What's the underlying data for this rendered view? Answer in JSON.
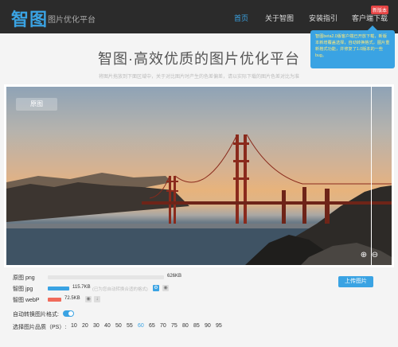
{
  "header": {
    "logo": "智图",
    "subtitle": "图片优化平台",
    "nav": [
      {
        "label": "首页",
        "active": true
      },
      {
        "label": "关于智图",
        "active": false
      },
      {
        "label": "安装指引",
        "active": false
      },
      {
        "label": "客户端下载",
        "active": false
      }
    ],
    "new_badge": "新版本",
    "bubble_text": "智图beta2.0版客户端已开放下载，新版本新增覆盖选择，自动转换格式，图片重新格式功能，并修复了1.0版本的一些bug。"
  },
  "main": {
    "title": "智图·高效优质的图片优化平台",
    "hint": "将图片拖放到下面区域中，关于对比图片时产生的色差偏差，请以实际下载的图片色差对比为准"
  },
  "preview": {
    "original_button": "原图"
  },
  "results": {
    "rows": [
      {
        "label": "原图 png",
        "size": "626KB",
        "fraction": 1.0
      },
      {
        "label": "智图 jpg",
        "size": "115.7KB",
        "note": "(已为您自动转换合适的格式)",
        "fraction": 0.185
      },
      {
        "label": "智图 webP",
        "size": "72.5KB",
        "fraction": 0.116
      }
    ],
    "upload_button": "上传图片",
    "auto_convert_label": "自动转换图片格式:",
    "auto_convert_on": true,
    "quality_label": "选择图片品质（PS）:",
    "quality_options": [
      "10",
      "20",
      "30",
      "40",
      "50",
      "55",
      "60",
      "65",
      "70",
      "75",
      "80",
      "85",
      "90",
      "95"
    ],
    "quality_selected": "60"
  },
  "colors": {
    "accent": "#3aa3e3",
    "header_bg": "#2b2b2b",
    "webp_bar": "#f06b5b",
    "badge": "#e64545"
  }
}
